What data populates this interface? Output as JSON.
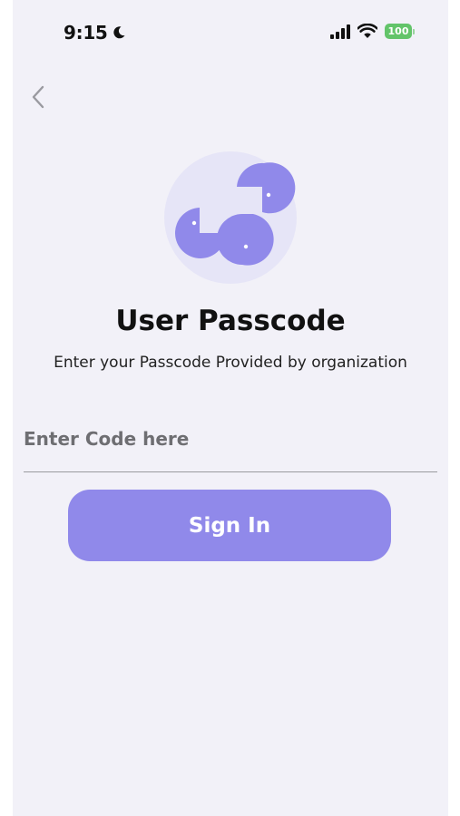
{
  "status_bar": {
    "time": "9:15",
    "battery": "100"
  },
  "icons": {
    "moon": "moon-icon",
    "signal": "cellular-signal-icon",
    "wifi": "wifi-icon",
    "battery": "battery-icon",
    "back": "chevron-left-icon",
    "logo": "app-logo"
  },
  "colors": {
    "background": "#f2f1f8",
    "accent": "#9089ea",
    "logo_circle": "#e6e5f7",
    "battery": "#63c46a"
  },
  "page": {
    "title": "User Passcode",
    "subtitle": "Enter your Passcode Provided by organization"
  },
  "form": {
    "code_placeholder": "Enter Code here",
    "code_value": "",
    "submit_label": "Sign In"
  }
}
